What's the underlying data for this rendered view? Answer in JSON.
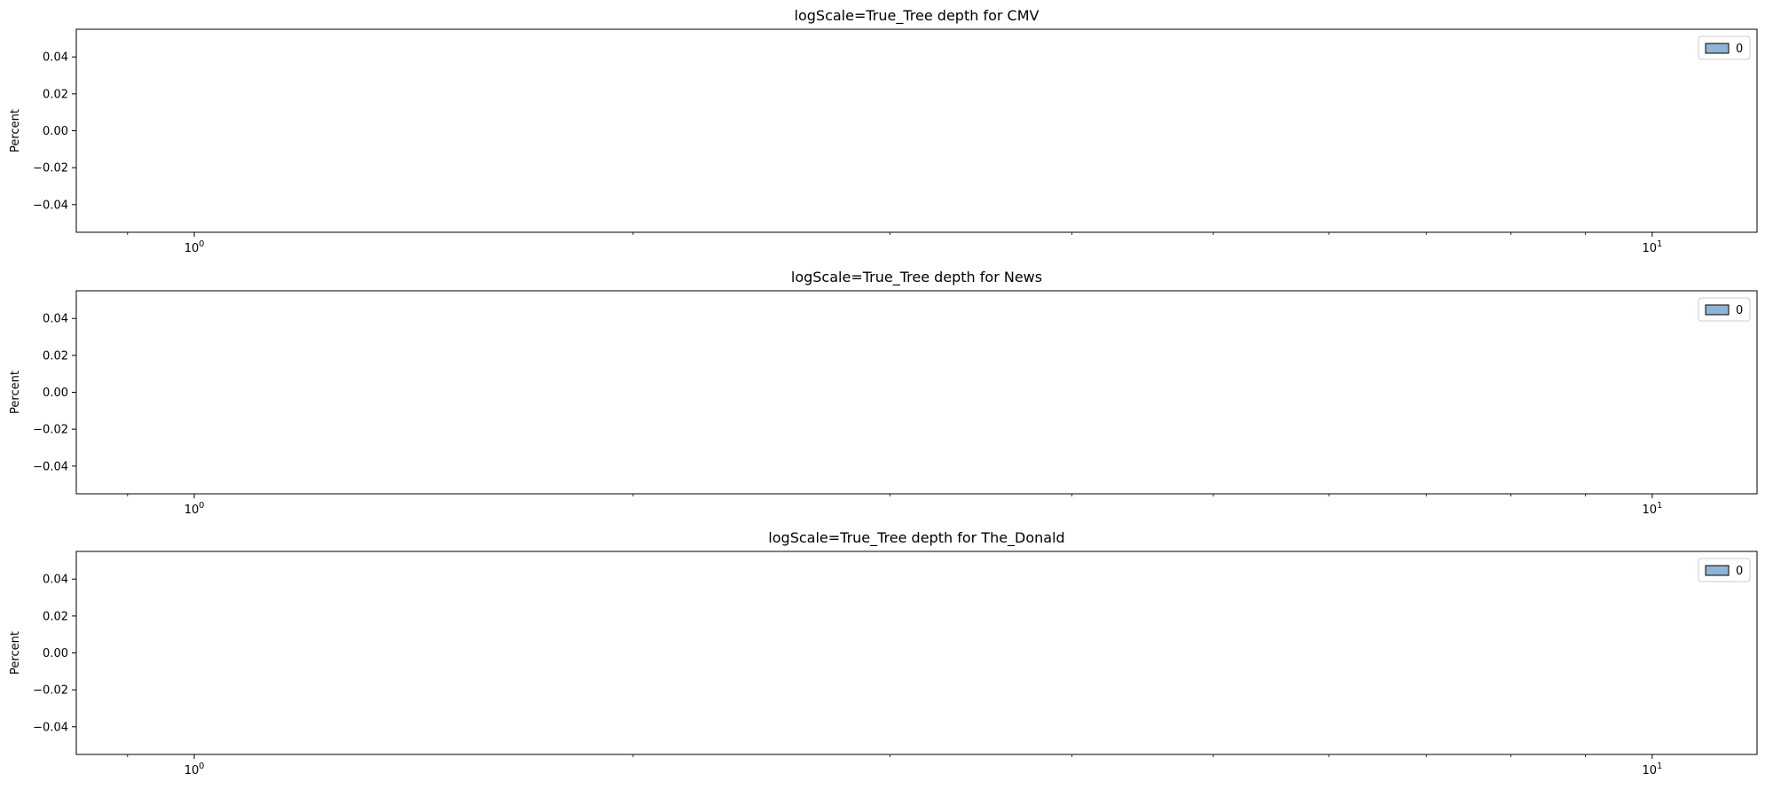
{
  "chart_data": [
    {
      "type": "bar",
      "title": "logScale=True_Tree depth for CMV",
      "xlabel": "",
      "ylabel": "Percent",
      "xscale": "log",
      "xlim": [
        0.83,
        11.8
      ],
      "ylim": [
        -0.055,
        0.055
      ],
      "x_ticks": [
        {
          "value": 1,
          "label": "10^0"
        },
        {
          "value": 10,
          "label": "10^1"
        }
      ],
      "y_ticks": [
        0.04,
        0.02,
        0.0,
        -0.02,
        -0.04
      ],
      "y_tick_labels": [
        "0.04",
        "0.02",
        "0.00",
        "−0.02",
        "−0.04"
      ],
      "grid": false,
      "legend": {
        "position": "top-right",
        "entries": [
          "0"
        ],
        "color": "#8fb3d4"
      },
      "series": [
        {
          "name": "0",
          "values": []
        }
      ]
    },
    {
      "type": "bar",
      "title": "logScale=True_Tree depth for News",
      "xlabel": "",
      "ylabel": "Percent",
      "xscale": "log",
      "xlim": [
        0.83,
        11.8
      ],
      "ylim": [
        -0.055,
        0.055
      ],
      "x_ticks": [
        {
          "value": 1,
          "label": "10^0"
        },
        {
          "value": 10,
          "label": "10^1"
        }
      ],
      "y_ticks": [
        0.04,
        0.02,
        0.0,
        -0.02,
        -0.04
      ],
      "y_tick_labels": [
        "0.04",
        "0.02",
        "0.00",
        "−0.02",
        "−0.04"
      ],
      "grid": false,
      "legend": {
        "position": "top-right",
        "entries": [
          "0"
        ],
        "color": "#8fb3d4"
      },
      "series": [
        {
          "name": "0",
          "values": []
        }
      ]
    },
    {
      "type": "bar",
      "title": "logScale=True_Tree depth for The_Donald",
      "xlabel": "",
      "ylabel": "Percent",
      "xscale": "log",
      "xlim": [
        0.83,
        11.8
      ],
      "ylim": [
        -0.055,
        0.055
      ],
      "x_ticks": [
        {
          "value": 1,
          "label": "10^0"
        },
        {
          "value": 10,
          "label": "10^1"
        }
      ],
      "y_ticks": [
        0.04,
        0.02,
        0.0,
        -0.02,
        -0.04
      ],
      "y_tick_labels": [
        "0.04",
        "0.02",
        "0.00",
        "−0.02",
        "−0.04"
      ],
      "grid": false,
      "legend": {
        "position": "top-right",
        "entries": [
          "0"
        ],
        "color": "#8fb3d4"
      },
      "series": [
        {
          "name": "0",
          "values": []
        }
      ]
    }
  ]
}
